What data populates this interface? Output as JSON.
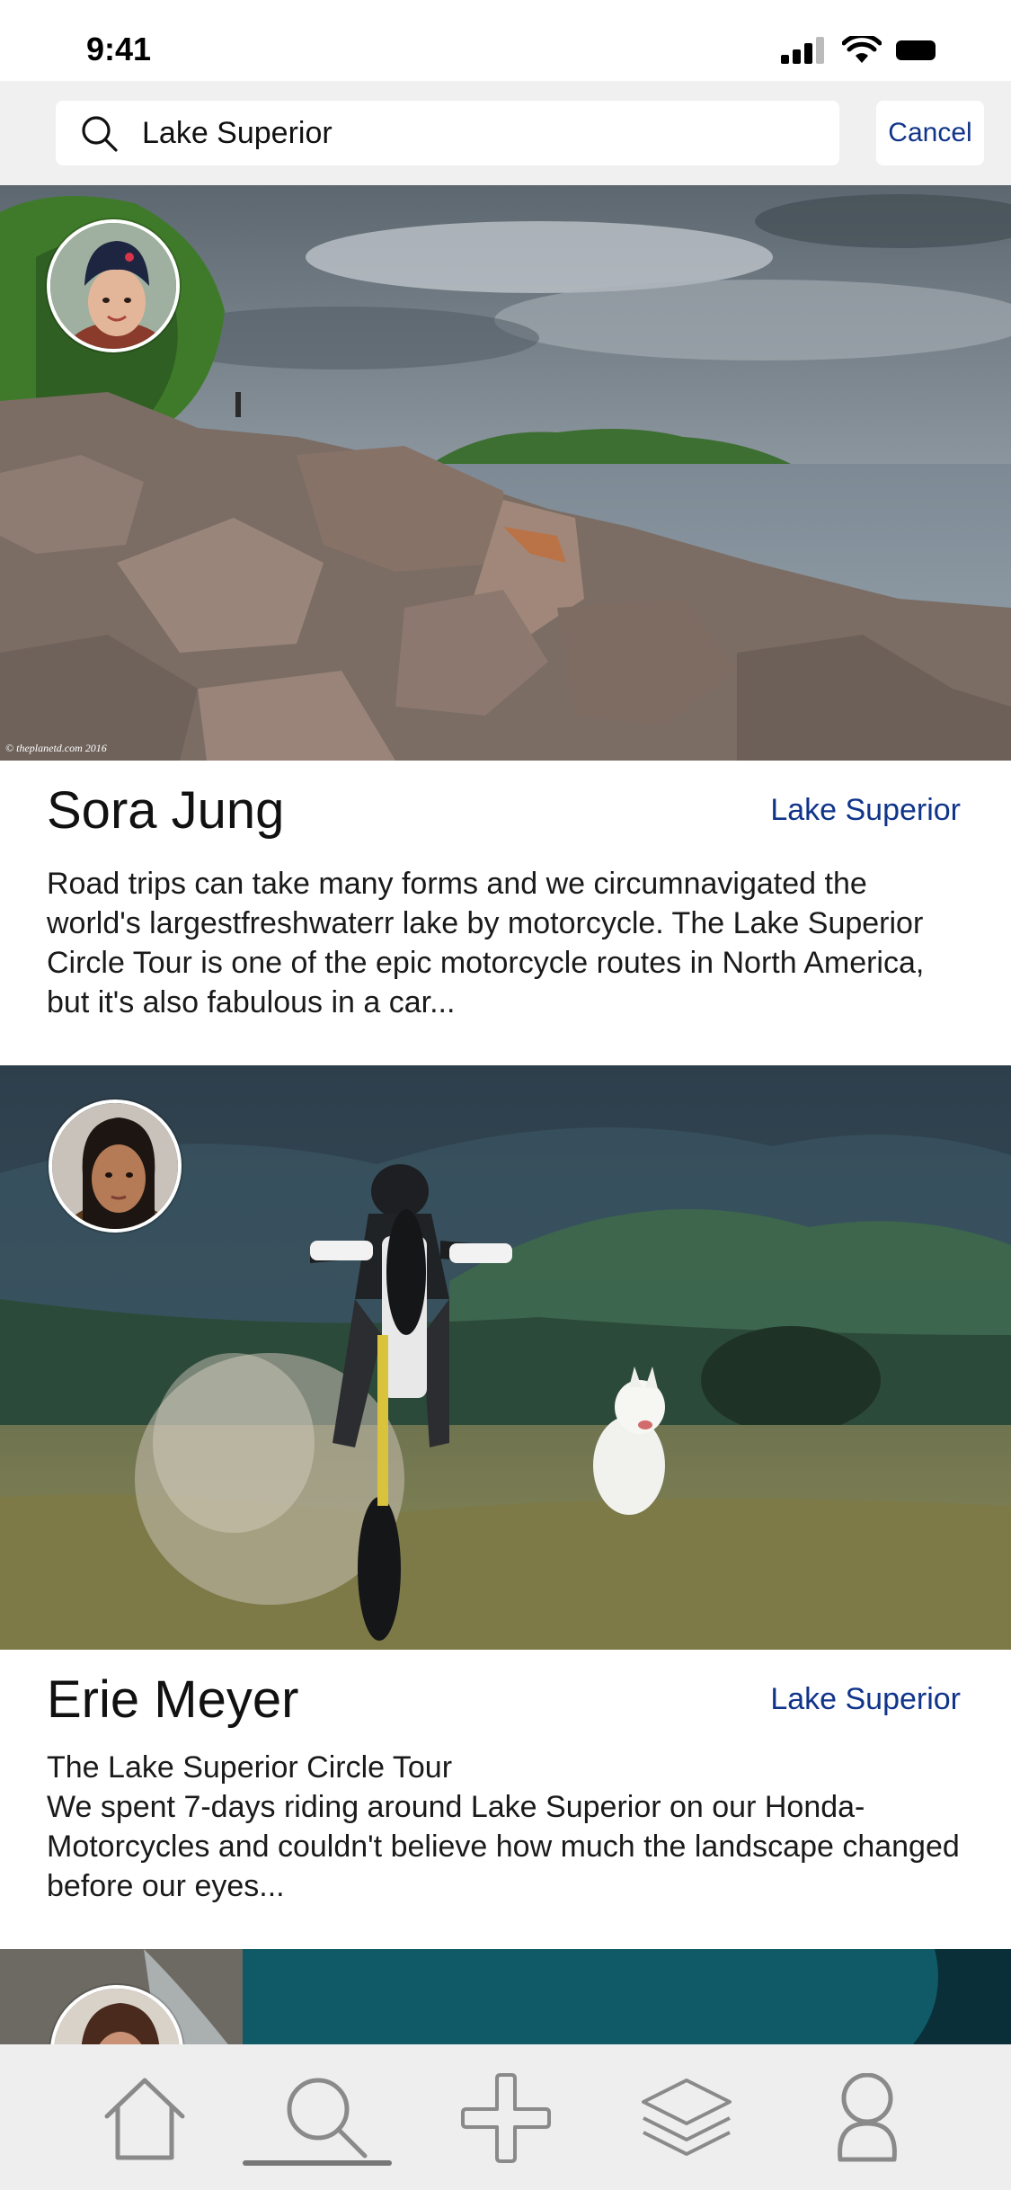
{
  "status_bar": {
    "time": "9:41",
    "icons": [
      "cellular-signal-icon",
      "wifi-icon",
      "battery-icon"
    ]
  },
  "search": {
    "value": "Lake Superior",
    "cancel_label": "Cancel"
  },
  "posts": [
    {
      "author": "Sora Jung",
      "location": "Lake Superior",
      "text": "Road trips can take many forms and we circumnavigated the world's largestfreshwaterr lake by motorcycle. The Lake Superior Circle Tour is one of the epic motorcycle routes in North America, but it's also fabulous in a car...",
      "photo_credit": "© theplanetd.com 2016"
    },
    {
      "author": "Erie Meyer",
      "location": "Lake Superior",
      "text_line1": "The Lake Superior Circle Tour",
      "text": "We spent 7-days riding around Lake Superior on our Honda-Motorcycles and couldn't believe how much the landscape changed before our eyes..."
    },
    {
      "author": "",
      "location": ""
    }
  ],
  "tab_bar": {
    "tabs": [
      "home-icon",
      "search-icon",
      "add-icon",
      "layers-icon",
      "profile-icon"
    ],
    "active": "search-icon"
  },
  "colors": {
    "accent": "#10348a",
    "header_bg": "#f0f0f0",
    "tab_bar_bg": "#eeeeee",
    "icon_gray": "#8a8a8a"
  }
}
